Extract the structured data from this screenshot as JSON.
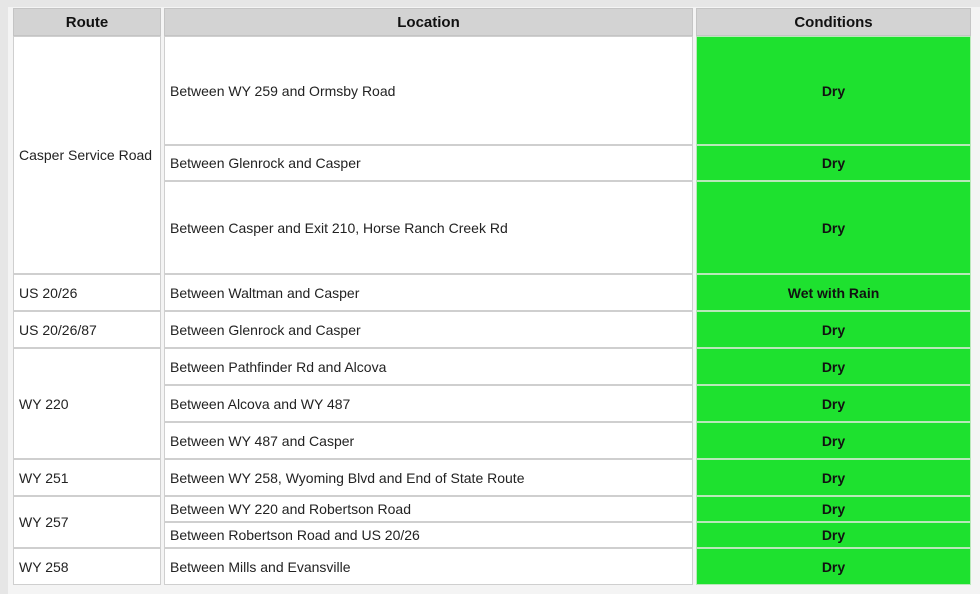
{
  "headers": {
    "route": "Route",
    "location": "Location",
    "conditions": "Conditions"
  },
  "colors": {
    "condition_ok": "#1ee12f",
    "header_bg": "#d3d3d3"
  },
  "routes": [
    {
      "route": "Casper Service Road",
      "segments": [
        {
          "location": "Between WY 259 and Ormsby Road",
          "condition": "Dry"
        },
        {
          "location": "Between Glenrock and Casper",
          "condition": "Dry"
        },
        {
          "location": "Between Casper and Exit 210, Horse Ranch Creek Rd",
          "condition": "Dry"
        }
      ]
    },
    {
      "route": "US 20/26",
      "segments": [
        {
          "location": "Between Waltman and Casper",
          "condition": "Wet with Rain"
        }
      ]
    },
    {
      "route": "US 20/26/87",
      "segments": [
        {
          "location": "Between Glenrock and Casper",
          "condition": "Dry"
        }
      ]
    },
    {
      "route": "WY 220",
      "segments": [
        {
          "location": "Between Pathfinder Rd and Alcova",
          "condition": "Dry"
        },
        {
          "location": "Between Alcova and WY 487",
          "condition": "Dry"
        },
        {
          "location": "Between WY 487 and Casper",
          "condition": "Dry"
        }
      ]
    },
    {
      "route": "WY 251",
      "segments": [
        {
          "location": "Between WY 258, Wyoming Blvd and End of State Route",
          "condition": "Dry"
        }
      ]
    },
    {
      "route": "WY 257",
      "segments": [
        {
          "location": "Between WY 220 and Robertson Road",
          "condition": "Dry"
        },
        {
          "location": "Between Robertson Road and US 20/26",
          "condition": "Dry"
        }
      ]
    },
    {
      "route": "WY 258",
      "segments": [
        {
          "location": "Between Mills and Evansville",
          "condition": "Dry"
        }
      ]
    }
  ]
}
